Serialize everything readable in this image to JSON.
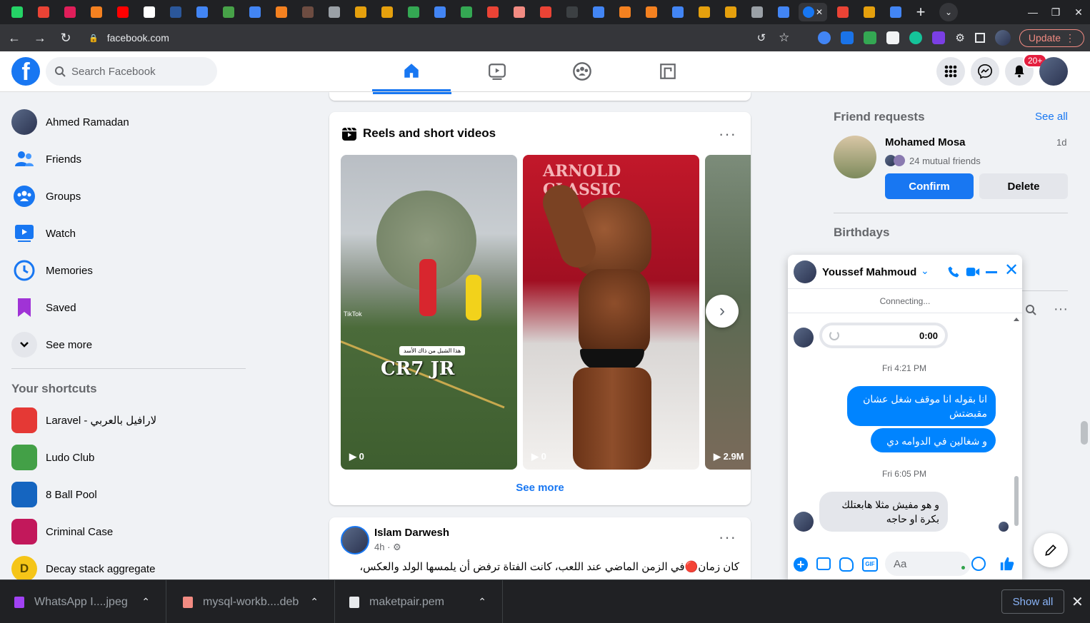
{
  "browser": {
    "tab_colors": [
      "#25d366",
      "#ea4335",
      "#e01e5a",
      "#f48120",
      "#ff0000",
      "#ffffff",
      "#2b579a",
      "#4285f4",
      "#47a248",
      "#4285f4",
      "#f48120",
      "#6d4c41",
      "#9aa0a6",
      "#e5a00d",
      "#e5a00d",
      "#34a853",
      "#4285f4",
      "#34a853",
      "#ea4335",
      "#f28b82",
      "#ea4335",
      "#3c4043",
      "#4285f4",
      "#f48120",
      "#f48120",
      "#4285f4",
      "#e5a00d",
      "#e5a00d",
      "#9aa0a6",
      "#4285f4",
      "#ea4335",
      "#e5a00d",
      "#4285f4"
    ],
    "active_tab_icon": "facebook-icon",
    "address": "facebook.com",
    "update_label": "Update"
  },
  "fb": {
    "search_placeholder": "Search Facebook",
    "notif_badge": "20+"
  },
  "sidebar": {
    "items": [
      {
        "label": "Ahmed Ramadan",
        "icon": "avatar"
      },
      {
        "label": "Friends",
        "icon": "friends-icon"
      },
      {
        "label": "Groups",
        "icon": "groups-icon"
      },
      {
        "label": "Watch",
        "icon": "watch-icon"
      },
      {
        "label": "Memories",
        "icon": "memories-icon"
      },
      {
        "label": "Saved",
        "icon": "saved-icon"
      },
      {
        "label": "See more",
        "icon": "chevron-down-icon"
      }
    ],
    "shortcuts_title": "Your shortcuts",
    "shortcuts": [
      {
        "label": "Laravel - لارافيل بالعربي",
        "color": "#e53935"
      },
      {
        "label": "Ludo Club",
        "color": "#43a047"
      },
      {
        "label": "8 Ball Pool",
        "color": "#1565c0"
      },
      {
        "label": "Criminal Case",
        "color": "#c2185b"
      },
      {
        "label": "Decay stack aggregate",
        "color": "#f5c518",
        "letter": "D"
      }
    ]
  },
  "reels": {
    "title": "Reels and short videos",
    "items": [
      {
        "count": "0",
        "caption": "CR7 JR",
        "subcaption": "هذا الشبل من ذاك الأسد",
        "watermark": "TikTok"
      },
      {
        "count": "0",
        "banner": "ARNOLD CLASSIC"
      },
      {
        "count": "2.9M"
      }
    ],
    "see_more": "See more"
  },
  "post": {
    "author": "Islam Darwesh",
    "time": "4h ·",
    "text": "كان زمان🔴في الزمن الماضي عند اللعب، كانت الفتاة ترفض أن يلمسها الولد والعكس،"
  },
  "right": {
    "friend_requests_title": "Friend requests",
    "see_all": "See all",
    "request": {
      "name": "Mohamed Mosa",
      "age": "1d",
      "mutual": "24 mutual friends"
    },
    "confirm": "Confirm",
    "delete": "Delete",
    "birthdays_title": "Birthdays"
  },
  "chat": {
    "name": "Youssef Mahmoud",
    "status": "Connecting...",
    "audio_time": "0:00",
    "ts1": "Fri 4:21 PM",
    "msg1": "انا بقوله انا موقف شغل عشان مقبضتش",
    "msg2": "و شغالين في الدوامه دي",
    "ts2": "Fri 6:05 PM",
    "msg3": "و هو مفيش مثلا هابعتلك بكرة او حاجه",
    "input_placeholder": "Aa"
  },
  "downloads": {
    "items": [
      {
        "name": "WhatsApp I....jpeg",
        "color": "#a142f4"
      },
      {
        "name": "mysql-workb....deb",
        "color": "#f28b82"
      },
      {
        "name": "maketpair.pem",
        "color": "#e8eaed"
      }
    ],
    "show_all": "Show all"
  }
}
